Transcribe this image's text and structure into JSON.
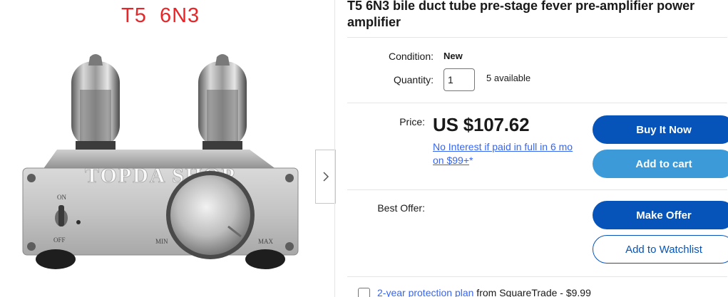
{
  "gallery": {
    "caption": "T5  6N3",
    "watermark": "TOPDA SHOP",
    "switch_on": "ON",
    "switch_off": "OFF",
    "knob_min": "MIN",
    "knob_max": "MAX",
    "next_icon": "chevron-right-icon"
  },
  "listing": {
    "title": "T5 6N3 bile duct tube pre-stage fever pre-amplifier power amplifier",
    "condition_label": "Condition:",
    "condition_value": "New",
    "quantity_label": "Quantity:",
    "quantity_value": "1",
    "available": "5 available",
    "price_label": "Price:",
    "price": "US $107.62",
    "finance_text": "No Interest if paid in full in 6 mo on $99+",
    "finance_asterisk": "*",
    "best_offer_label": "Best Offer:"
  },
  "actions": {
    "buy_now": "Buy It Now",
    "add_to_cart": "Add to cart",
    "make_offer": "Make Offer",
    "add_to_watchlist": "Add to Watchlist"
  },
  "protection": {
    "link": "2-year protection plan",
    "text": " from SquareTrade - $9.99"
  },
  "colors": {
    "primary": "#0654ba",
    "secondary": "#3d9ad8",
    "link": "#3665f3",
    "caption": "#e8262a"
  }
}
